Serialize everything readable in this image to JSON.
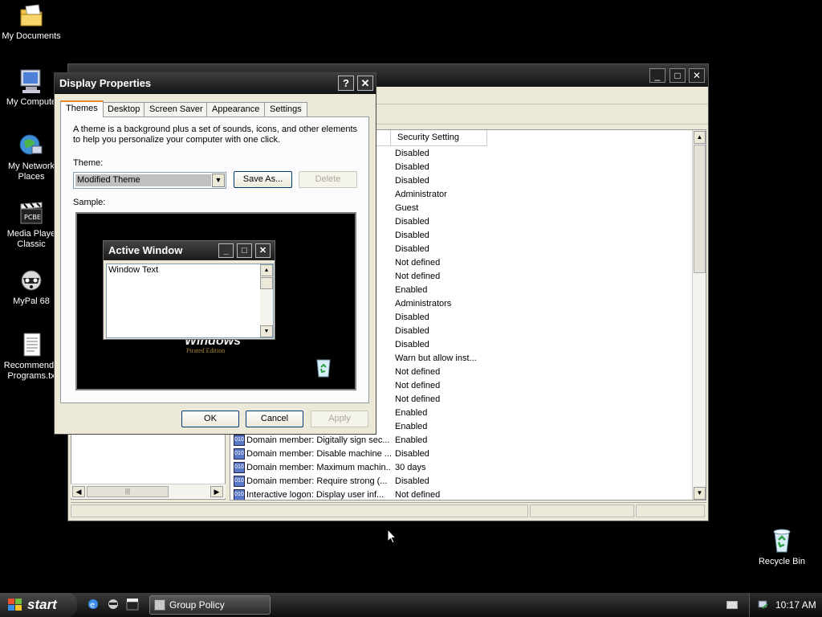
{
  "desktop": {
    "icons": [
      {
        "label": "My Documents"
      },
      {
        "label": "My Compute"
      },
      {
        "label": "My Network Places"
      },
      {
        "label": "Media Playe Classic"
      },
      {
        "label": "MyPal 68"
      },
      {
        "label": "Recommende Programs.tx"
      },
      {
        "label": "Recycle Bin"
      }
    ]
  },
  "gp_window": {
    "columns": {
      "setting": "Security Setting"
    },
    "rows": [
      {
        "policy": "",
        "setting": "Disabled"
      },
      {
        "policy": "",
        "setting": "Disabled"
      },
      {
        "policy": "",
        "setting": "Disabled"
      },
      {
        "policy": "",
        "setting": "Administrator"
      },
      {
        "policy": "",
        "setting": "Guest"
      },
      {
        "policy": "",
        "setting": "Disabled"
      },
      {
        "policy": "",
        "setting": "Disabled"
      },
      {
        "policy": "",
        "setting": "Disabled"
      },
      {
        "policy": "",
        "setting": "Not defined"
      },
      {
        "policy": "",
        "setting": "Not defined"
      },
      {
        "policy": "",
        "setting": "Enabled"
      },
      {
        "policy": "",
        "setting": "Administrators"
      },
      {
        "policy": "",
        "setting": "Disabled"
      },
      {
        "policy": "",
        "setting": "Disabled"
      },
      {
        "policy": "",
        "setting": "Disabled"
      },
      {
        "policy": "",
        "setting": "Warn but allow inst..."
      },
      {
        "policy": "",
        "setting": "Not defined"
      },
      {
        "policy": "",
        "setting": "Not defined"
      },
      {
        "policy": "",
        "setting": "Not defined"
      },
      {
        "policy": "",
        "setting": "Enabled"
      },
      {
        "policy": "",
        "setting": "Enabled"
      },
      {
        "policy": "Domain member: Digitally sign sec...",
        "setting": "Enabled"
      },
      {
        "policy": "Domain member: Disable machine ...",
        "setting": "Disabled"
      },
      {
        "policy": "Domain member: Maximum machin...",
        "setting": "30 days"
      },
      {
        "policy": "Domain member: Require strong (...",
        "setting": "Disabled"
      },
      {
        "policy": "Interactive logon: Display user inf...",
        "setting": "Not defined"
      }
    ]
  },
  "dialog": {
    "title": "Display Properties",
    "help_glyph": "?",
    "close_glyph": "✕",
    "tabs": [
      "Themes",
      "Desktop",
      "Screen Saver",
      "Appearance",
      "Settings"
    ],
    "description": "A theme is a background plus a set of sounds, icons, and other elements to help you personalize your computer with one click.",
    "theme_label": "Theme:",
    "theme_value": "Modified Theme",
    "save_as_label": "Save As...",
    "delete_label": "Delete",
    "sample_label": "Sample:",
    "sample": {
      "window_title": "Active Window",
      "window_text": "Window Text",
      "logo_text": "Windows",
      "logo_sub": "Pirated Edition"
    },
    "ok_label": "OK",
    "cancel_label": "Cancel",
    "apply_label": "Apply"
  },
  "taskbar": {
    "start_label": "start",
    "task_item": "Group Policy",
    "clock": "10:17 AM"
  }
}
